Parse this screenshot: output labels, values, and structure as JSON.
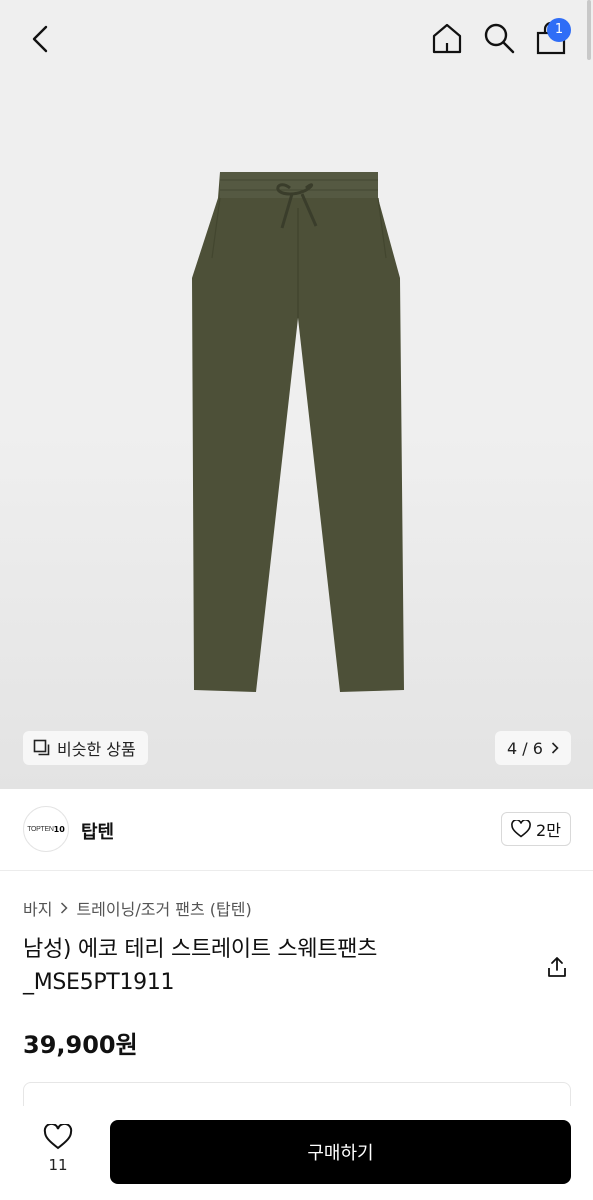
{
  "header": {
    "icons": [
      "back-arrow-icon",
      "home-icon",
      "search-icon",
      "shopping-bag-icon"
    ],
    "cart_count": "1"
  },
  "gallery": {
    "similar_label": "비슷한 상품",
    "pager": "4 / 6",
    "product_color": "#4d5038"
  },
  "brand": {
    "logo_text": "TOPTEN",
    "logo_mark": "10",
    "name": "탑텐",
    "likes": "2만"
  },
  "breadcrumb": {
    "category": "바지",
    "subcategory": "트레이닝/조거 팬츠 (탑텐)"
  },
  "product": {
    "title": "남성) 에코 테리 스트레이트 스웨트팬츠_MSE5PT1911",
    "price": "39,900원"
  },
  "bottom": {
    "wish_count": "11",
    "buy_label": "구매하기",
    "buy_color": "#000000"
  }
}
